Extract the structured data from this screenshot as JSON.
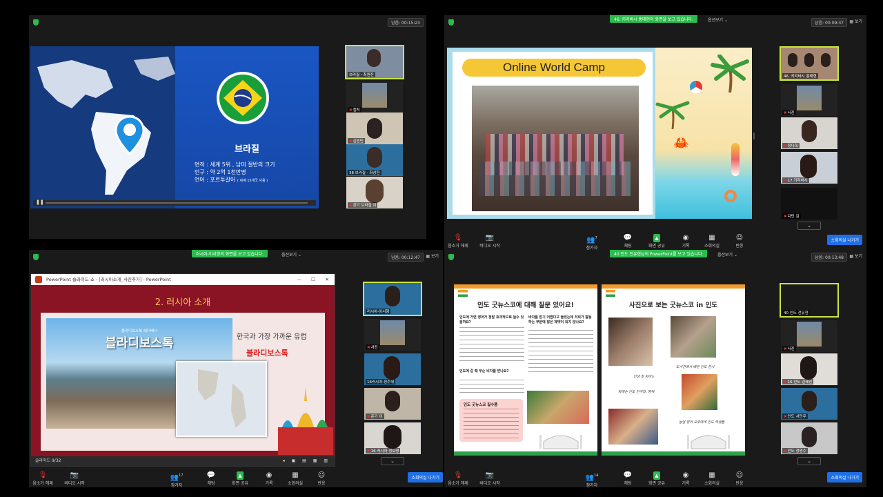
{
  "q1": {
    "timer": "남음: 00:15:23",
    "slide": {
      "country": "브라질",
      "lines": [
        "면적 : 세계 5위 , 남미 절반의 크기",
        "인구 : 약 2억 1천만명",
        "언어 : 포르투갈어"
      ],
      "lang_note": "( 세계 15개국 사용 )",
      "flag_colors": {
        "green": "#1a9e3a",
        "yellow": "#f7d417",
        "blue": "#1e3a8a"
      }
    },
    "thumbs": [
      "브라질 - 최원진",
      "캡처",
      "김원민",
      "38 브라질 - 최상현",
      "강기 브라질 이"
    ]
  },
  "q2": {
    "banner": "46. 키리바시 홍태현의 화면을 보고 있습니다.",
    "options": "옵션보기",
    "timer": "남음: 00:09:37",
    "view": "보기",
    "slide_title": "Online World Camp",
    "thumbs": [
      "46. 키리바시 홍태현",
      "사진",
      "정다희",
      "17 키리바시",
      "다민 김"
    ],
    "toolbar": [
      {
        "icon": "mic-off-icon",
        "glyph": "🎙",
        "label": "음소거 해제"
      },
      {
        "icon": "video-off-icon",
        "glyph": "📷",
        "label": "비디오 시작"
      },
      {
        "icon": "participants-icon",
        "glyph": "👥",
        "label": "참가자",
        "count": "7"
      },
      {
        "icon": "chat-icon",
        "glyph": "💬",
        "label": "채팅"
      },
      {
        "icon": "share-screen-icon",
        "glyph": "▲",
        "label": "화면 공유"
      },
      {
        "icon": "record-icon",
        "glyph": "◉",
        "label": "기록"
      },
      {
        "icon": "breakout-icon",
        "glyph": "▦",
        "label": "소회의실"
      },
      {
        "icon": "reaction-icon",
        "glyph": "☺",
        "label": "반응"
      }
    ],
    "leave": "소회의실 나가기"
  },
  "q3": {
    "banner": "러시아-이서형의 화면을 보고 있습니다.",
    "options": "옵션보기",
    "timer": "남음: 00:12:47",
    "view": "보기",
    "ppt_title": "PowerPoint 슬라이드 쇼 - [러시아소개_사진추가] - PowerPoint",
    "slide_heading": "2. 러시아 소개",
    "slide_banner": "블라디보스톡",
    "slide_small": "블라디보스톡 헤더배너",
    "side_text1": "한국과 가장 가까운 유럽",
    "side_text2": "블라디보스톡",
    "slide_count": "슬라이드 9/32",
    "thumbs": [
      "러시아-이서형",
      "사진",
      "16러시아-정주위",
      "준기 이",
      "16 러시아 정보명"
    ],
    "toolbar": [
      {
        "icon": "mic-off-icon",
        "glyph": "🎙",
        "label": "음소거 해제"
      },
      {
        "icon": "video-off-icon",
        "glyph": "📷",
        "label": "비디오 시작"
      },
      {
        "icon": "participants-icon",
        "glyph": "👥",
        "label": "참가자",
        "count": "17"
      },
      {
        "icon": "chat-icon",
        "glyph": "💬",
        "label": "채팅"
      },
      {
        "icon": "share-screen-icon",
        "glyph": "▲",
        "label": "화면 공유"
      },
      {
        "icon": "record-icon",
        "glyph": "◉",
        "label": "기록"
      },
      {
        "icon": "breakout-icon",
        "glyph": "▦",
        "label": "소회의실"
      },
      {
        "icon": "reaction-icon",
        "glyph": "☺",
        "label": "반응"
      }
    ],
    "leave": "소회의실 나가기"
  },
  "q4": {
    "banner": "40 인도 전유현님의 PowerPoint를 보고 있습니다.",
    "options": "옵션보기",
    "timer": "남음: 00:13:48",
    "view": "보기",
    "left_title": "인도 굿뉴스코에 대해 질문 있어요!",
    "q_a": "인도에 가면 영어가 정말 효과적으로 늘수 있을까요?",
    "q_b": "바자를 받기 어렵다고 들었는데 저희가 활동하는 부분에 많은 제약이 되지 않나요?",
    "q_c": "인도에 갈 때 무슨 비자를 받나요?",
    "tips_title": "인도 굿뉴스코 필수품",
    "right_title": "사진으로 보는 굿뉴스코 in 인도",
    "caption1": "인생 첫 피아노",
    "caption2": "도서관에서 배운 인도 전시",
    "caption3": "파에손 인도 친구와, 빵떡",
    "caption4": "농업 영어 오후에게 인도 학생들",
    "thumbs": [
      "40 인도 전유현",
      "사진",
      "16 인도 김혜진",
      "인도 서민우",
      "인도 정영수"
    ],
    "toolbar": [
      {
        "icon": "mic-off-icon",
        "glyph": "🎙",
        "label": "음소거 해제"
      },
      {
        "icon": "video-off-icon",
        "glyph": "📷",
        "label": "비디오 시작"
      },
      {
        "icon": "participants-icon",
        "glyph": "👥",
        "label": "참가자",
        "count": "14"
      },
      {
        "icon": "chat-icon",
        "glyph": "💬",
        "label": "채팅"
      },
      {
        "icon": "share-screen-icon",
        "glyph": "▲",
        "label": "화면 공유"
      },
      {
        "icon": "record-icon",
        "glyph": "◉",
        "label": "기록"
      },
      {
        "icon": "breakout-icon",
        "glyph": "▦",
        "label": "소회의실"
      },
      {
        "icon": "reaction-icon",
        "glyph": "☺",
        "label": "반응"
      }
    ],
    "leave": "소회의실 나가기"
  }
}
